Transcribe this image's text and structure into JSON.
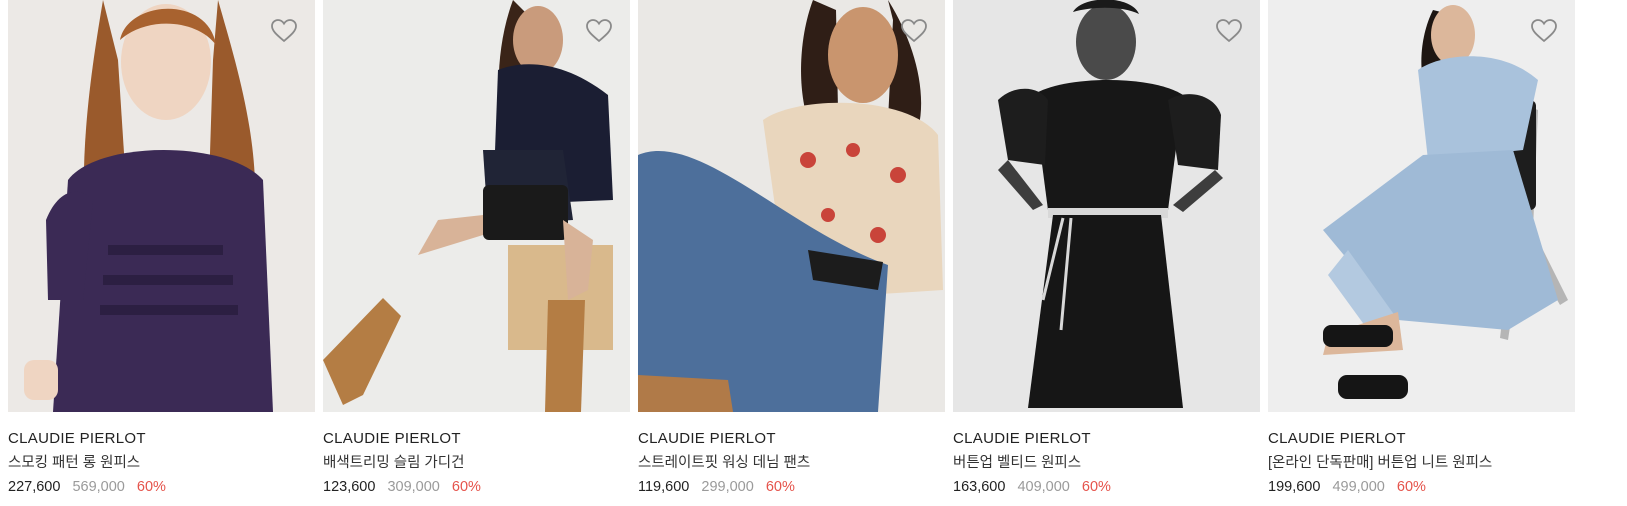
{
  "colors": {
    "sale_price": "#222222",
    "original_price": "#9a9a9a",
    "discount": "#e5534b",
    "heart_outline": "#8a8a8a"
  },
  "products": [
    {
      "image": "model-purple-smocked-long-dress",
      "brand": "CLAUDIE PIERLOT",
      "name": "스모킹 패턴 롱 원피스",
      "sale_price": "227,600",
      "original_price": "569,000",
      "discount": "60%"
    },
    {
      "image": "model-navy-slim-cardigan-boots",
      "brand": "CLAUDIE PIERLOT",
      "name": "배색트리밍 슬림 가디건",
      "sale_price": "123,600",
      "original_price": "309,000",
      "discount": "60%"
    },
    {
      "image": "model-floral-blouse-denim-pants",
      "brand": "CLAUDIE PIERLOT",
      "name": "스트레이트핏 워싱 데님 팬츠",
      "sale_price": "119,600",
      "original_price": "299,000",
      "discount": "60%"
    },
    {
      "image": "model-black-belted-dress",
      "brand": "CLAUDIE PIERLOT",
      "name": "버튼업 벨티드 원피스",
      "sale_price": "163,600",
      "original_price": "409,000",
      "discount": "60%"
    },
    {
      "image": "model-blue-knit-dress-chair",
      "brand": "CLAUDIE PIERLOT",
      "name": "[온라인 단독판매] 버튼업 니트 원피스",
      "sale_price": "199,600",
      "original_price": "499,000",
      "discount": "60%"
    }
  ]
}
